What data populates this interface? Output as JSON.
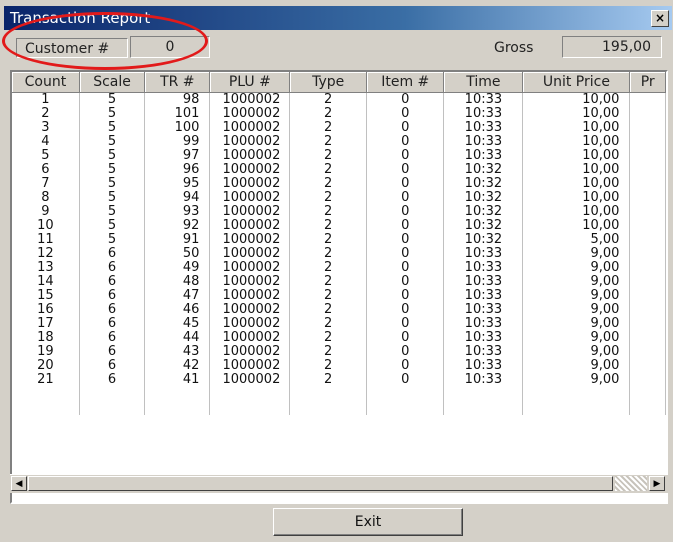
{
  "window": {
    "title": "Transaction Report",
    "close_glyph": "×"
  },
  "info": {
    "customer_label": "Customer #",
    "customer_value": "0",
    "gross_label": "Gross",
    "gross_value": "195,00"
  },
  "table": {
    "columns": [
      "Count",
      "Scale",
      "TR #",
      "PLU #",
      "Type",
      "Item #",
      "Time",
      "Unit Price",
      "Pr"
    ],
    "rows": [
      [
        "1",
        "5",
        "98",
        "1000002",
        "2",
        "0",
        "10:33",
        "10,00"
      ],
      [
        "2",
        "5",
        "101",
        "1000002",
        "2",
        "0",
        "10:33",
        "10,00"
      ],
      [
        "3",
        "5",
        "100",
        "1000002",
        "2",
        "0",
        "10:33",
        "10,00"
      ],
      [
        "4",
        "5",
        "99",
        "1000002",
        "2",
        "0",
        "10:33",
        "10,00"
      ],
      [
        "5",
        "5",
        "97",
        "1000002",
        "2",
        "0",
        "10:33",
        "10,00"
      ],
      [
        "6",
        "5",
        "96",
        "1000002",
        "2",
        "0",
        "10:32",
        "10,00"
      ],
      [
        "7",
        "5",
        "95",
        "1000002",
        "2",
        "0",
        "10:32",
        "10,00"
      ],
      [
        "8",
        "5",
        "94",
        "1000002",
        "2",
        "0",
        "10:32",
        "10,00"
      ],
      [
        "9",
        "5",
        "93",
        "1000002",
        "2",
        "0",
        "10:32",
        "10,00"
      ],
      [
        "10",
        "5",
        "92",
        "1000002",
        "2",
        "0",
        "10:32",
        "10,00"
      ],
      [
        "11",
        "5",
        "91",
        "1000002",
        "2",
        "0",
        "10:32",
        "5,00"
      ],
      [
        "12",
        "6",
        "50",
        "1000002",
        "2",
        "0",
        "10:33",
        "9,00"
      ],
      [
        "13",
        "6",
        "49",
        "1000002",
        "2",
        "0",
        "10:33",
        "9,00"
      ],
      [
        "14",
        "6",
        "48",
        "1000002",
        "2",
        "0",
        "10:33",
        "9,00"
      ],
      [
        "15",
        "6",
        "47",
        "1000002",
        "2",
        "0",
        "10:33",
        "9,00"
      ],
      [
        "16",
        "6",
        "46",
        "1000002",
        "2",
        "0",
        "10:33",
        "9,00"
      ],
      [
        "17",
        "6",
        "45",
        "1000002",
        "2",
        "0",
        "10:33",
        "9,00"
      ],
      [
        "18",
        "6",
        "44",
        "1000002",
        "2",
        "0",
        "10:33",
        "9,00"
      ],
      [
        "19",
        "6",
        "43",
        "1000002",
        "2",
        "0",
        "10:33",
        "9,00"
      ],
      [
        "20",
        "6",
        "42",
        "1000002",
        "2",
        "0",
        "10:33",
        "9,00"
      ],
      [
        "21",
        "6",
        "41",
        "1000002",
        "2",
        "0",
        "10:33",
        "9,00"
      ]
    ]
  },
  "scrollbar": {
    "left_glyph": "◀",
    "right_glyph": "▶"
  },
  "buttons": {
    "exit_label": "Exit"
  },
  "annotation": {
    "color": "#e21a1a"
  }
}
